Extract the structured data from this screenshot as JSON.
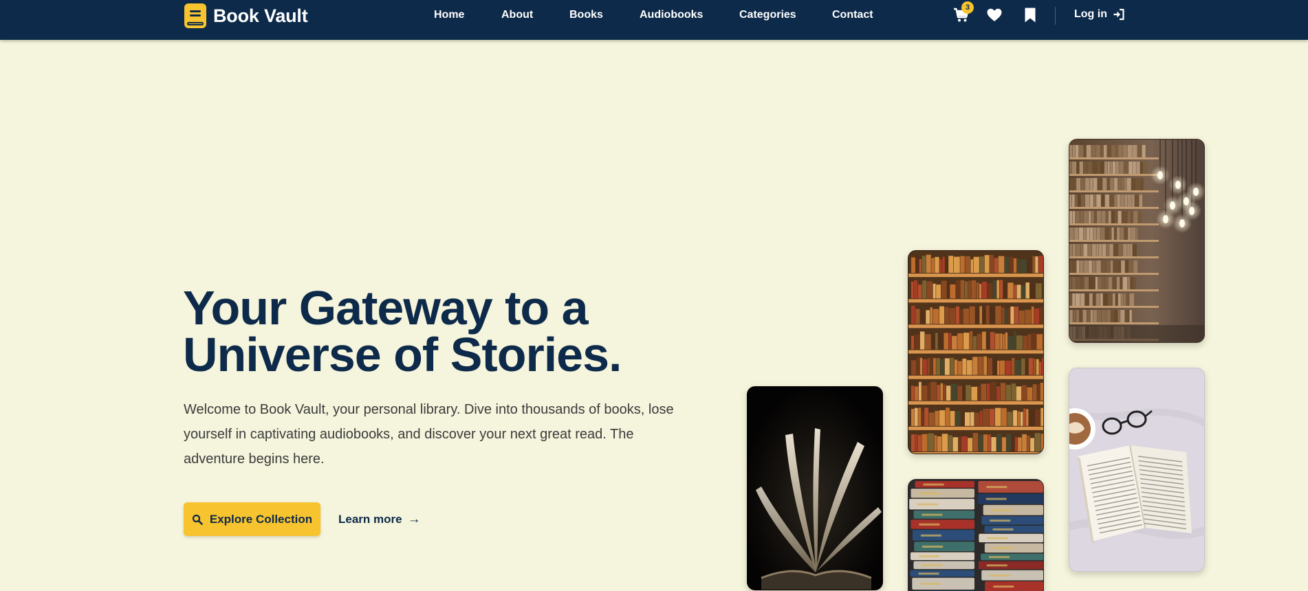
{
  "brand": {
    "name": "Book Vault",
    "icon": "book-icon"
  },
  "nav": {
    "links": [
      {
        "label": "Home"
      },
      {
        "label": "About"
      },
      {
        "label": "Books"
      },
      {
        "label": "Audiobooks"
      },
      {
        "label": "Categories"
      },
      {
        "label": "Contact"
      }
    ]
  },
  "header_actions": {
    "cart_icon": "cart-icon",
    "cart_count": "3",
    "wishlist_icon": "heart-icon",
    "bookmark_icon": "bookmark-icon",
    "login_label": "Log in",
    "login_icon": "sign-in-icon"
  },
  "hero": {
    "title_line1": "Your Gateway to a",
    "title_line2": "Universe of Stories.",
    "description": "Welcome to Book Vault, your personal library. Dive into thousands of books, lose yourself in captivating audiobooks, and discover your next great read. The adventure begins here.",
    "primary_button": {
      "label": "Explore Collection",
      "icon": "search-icon"
    },
    "secondary_button": {
      "label": "Learn more",
      "icon": "arrow-right-icon",
      "arrow": "→"
    }
  },
  "gallery": [
    {
      "subject": "open book on dark background"
    },
    {
      "subject": "wooden bookshelves full of books"
    },
    {
      "subject": "stack of colorful old books"
    },
    {
      "subject": "library aisle with hanging bulbs"
    },
    {
      "subject": "open book with glasses and coffee"
    }
  ],
  "colors": {
    "header_bg": "#0d2a4a",
    "page_bg": "#f5f4dc",
    "accent": "#f7c32e",
    "title": "#0d2a4a",
    "body_text": "#3b3b3b"
  }
}
